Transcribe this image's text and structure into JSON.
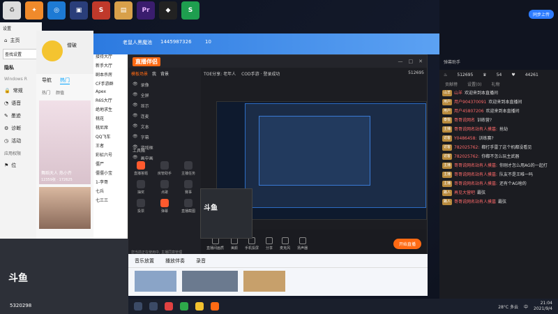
{
  "settings": {
    "title": "设置",
    "home": "主页",
    "search": "查找设置",
    "privacy": "隐私",
    "os": "Windows R",
    "items": [
      "常规",
      "语音",
      "墨迹",
      "诊断",
      "活动"
    ],
    "history": "应用权限",
    "pos": "位"
  },
  "qq": {
    "username": "僧破",
    "tabs": [
      "导航",
      "热门"
    ],
    "sub": [
      "热门",
      "颜值"
    ],
    "card_caption": "舞蹈天人 热小齐",
    "card_count": "12359张 · 172625"
  },
  "groups": {
    "items": [
      "音频模式",
      "名叔人聚",
      "接待大厅",
      "新手大厅",
      "剧本杀房",
      "CF手游群",
      "Apex",
      "R6S大厅",
      "绝地求生",
      "桃花",
      "桃尼席",
      "QQ飞车",
      "王者",
      "彩虹六号",
      "僵尸",
      "僵僵小宝",
      "1-李哥",
      "七兵",
      "七三三"
    ]
  },
  "bluewin": {
    "name": "老鼠人黑魔池",
    "id": "1445987326",
    "count": "10"
  },
  "zhibo": {
    "logo": "直播伴侣",
    "tabs": [
      "模板场景",
      "我",
      "背景"
    ],
    "scenes": [
      "录像",
      "全屏",
      "显示",
      "连麦",
      "文本",
      "字幕",
      "游戏框",
      "画中画"
    ],
    "tool_label": "工具箱",
    "tools": [
      "直播答题",
      "房管助手",
      "主播任务",
      "抽奖",
      "点歌",
      "赛事",
      "投票",
      "弹幕",
      "直播截图"
    ],
    "game": "TOE分享: 老年人",
    "status": "COD手游 · 登录成功",
    "counter": "512695",
    "bottom": [
      "直播间画质",
      "美颜",
      "手机投屏",
      "分享",
      "麦克风",
      "扬声器"
    ],
    "start": "开始直播",
    "hint": "您当前正在使用中, 主播同意管理",
    "time": "00:00:00"
  },
  "strip": {
    "tabs": [
      "音乐放置",
      "播放伴奏",
      "录音"
    ]
  },
  "danmu_top": {
    "title": "弹幕助手",
    "cloud": "同步上传"
  },
  "danmu": {
    "stats": [
      "512695",
      "54",
      "44261"
    ],
    "tabs": [
      "贡献榜",
      "设置(0)",
      "礼物"
    ],
    "messages": [
      {
        "badge": "山羊",
        "user": "山羊",
        "text": "欢迎来到本直播间"
      },
      {
        "badge": "用户",
        "user": "用户904370091",
        "text": "欢迎来到本直播间"
      },
      {
        "badge": "用户",
        "user": "用户45807206",
        "text": "欢迎来到本直播间"
      },
      {
        "badge": "泰悦",
        "user": "哥哥说网名",
        "text": "训练营?"
      },
      {
        "badge": "主播",
        "user": "哥哥说网名站有人摸墓:",
        "text": "抢劫"
      },
      {
        "badge": "访客",
        "user": "Y0486458:",
        "text": "训练赛?"
      },
      {
        "badge": "访客",
        "user": "782025762:",
        "text": "都打手雷了这个机都没看见"
      },
      {
        "badge": "访客",
        "user": "782025762:",
        "text": "你都不怎么玩主武器"
      },
      {
        "badge": "主播",
        "user": "哥哥说网名站有人摸墓:",
        "text": "你刚才怎么用AG的一起打"
      },
      {
        "badge": "主播",
        "user": "哥哥说网名站有人摸墓:",
        "text": "队友不是王唯一吗"
      },
      {
        "badge": "主播",
        "user": "哥哥说网名站有人摸墓:",
        "text": "还有个AG啥的"
      },
      {
        "badge": "路人",
        "user": "再见大营吧",
        "text": "霸弦"
      },
      {
        "badge": "路人",
        "user": "哥哥说网名站有人摸墓",
        "text": "霸弦"
      }
    ]
  },
  "facecam": {
    "logo": "斗鱼",
    "room": "5320298"
  },
  "taskbar": {
    "temp": "28°C 多云",
    "lang": "中",
    "time": "21:04",
    "date": "2021/9/4"
  }
}
